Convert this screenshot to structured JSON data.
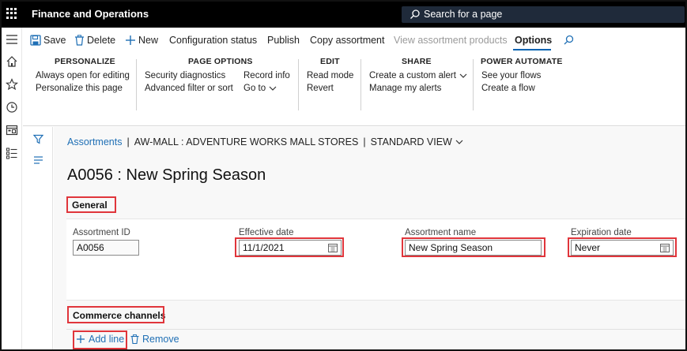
{
  "app": {
    "title": "Finance and Operations",
    "search_label": "Search for a page"
  },
  "toolbar": {
    "save": "Save",
    "delete": "Delete",
    "new": "New",
    "configuration_status": "Configuration status",
    "publish": "Publish",
    "copy_assortment": "Copy assortment",
    "view_assortment_products": "View assortment products",
    "options": "Options"
  },
  "ribbon": {
    "personalize": {
      "title": "PERSONALIZE",
      "items": [
        "Always open for editing",
        "Personalize this page"
      ]
    },
    "page_options": {
      "title": "PAGE OPTIONS",
      "items": [
        "Security diagnostics",
        "Advanced filter or sort",
        "Record info",
        "Go to"
      ]
    },
    "edit": {
      "title": "EDIT",
      "items": [
        "Read mode",
        "Revert"
      ]
    },
    "share": {
      "title": "SHARE",
      "items": [
        "Create a custom alert",
        "Manage my alerts"
      ]
    },
    "power_automate": {
      "title": "POWER AUTOMATE",
      "items": [
        "See your flows",
        "Create a flow"
      ]
    }
  },
  "breadcrumb": {
    "root": "Assortments",
    "sep": "|",
    "context": "AW-MALL : ADVENTURE WORKS MALL STORES",
    "view": "STANDARD VIEW"
  },
  "page": {
    "title": "A0056 : New Spring Season",
    "general_header": "General",
    "commerce_header": "Commerce channels"
  },
  "fields": {
    "assortment_id": {
      "label": "Assortment ID",
      "value": "A0056"
    },
    "effective_date": {
      "label": "Effective date",
      "value": "11/1/2021"
    },
    "assortment_name": {
      "label": "Assortment name",
      "value": "New Spring Season"
    },
    "expiration_date": {
      "label": "Expiration date",
      "value": "Never"
    }
  },
  "channels": {
    "add_line": "Add line",
    "remove": "Remove"
  },
  "colors": {
    "accent": "#0063b1",
    "highlight": "#e0353b",
    "link": "#1f6fb5"
  }
}
